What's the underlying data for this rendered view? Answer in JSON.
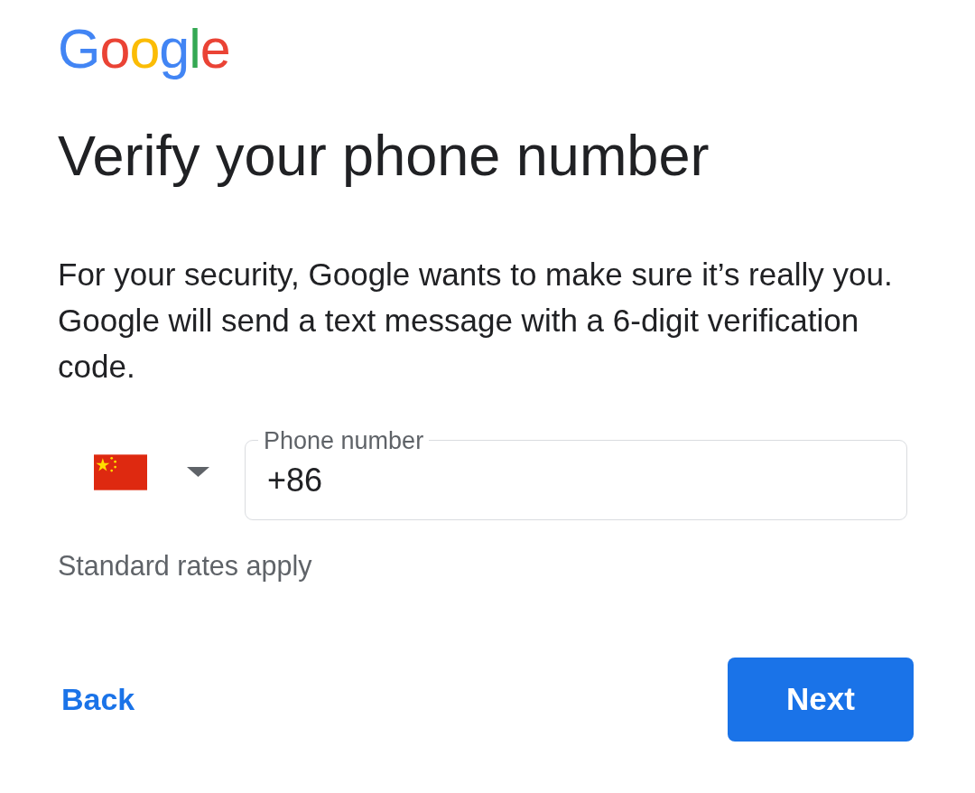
{
  "logo": {
    "text": "Google"
  },
  "title": "Verify your phone number",
  "description": "For your security, Google wants to make sure it’s really you. Google will send a text message with a 6-digit verification code.",
  "phone_field": {
    "label": "Phone number",
    "value": "+86"
  },
  "hint": "Standard rates apply",
  "buttons": [
    {
      "kind": "text",
      "label": "Back"
    },
    {
      "kind": "filled",
      "label": "Next"
    }
  ]
}
